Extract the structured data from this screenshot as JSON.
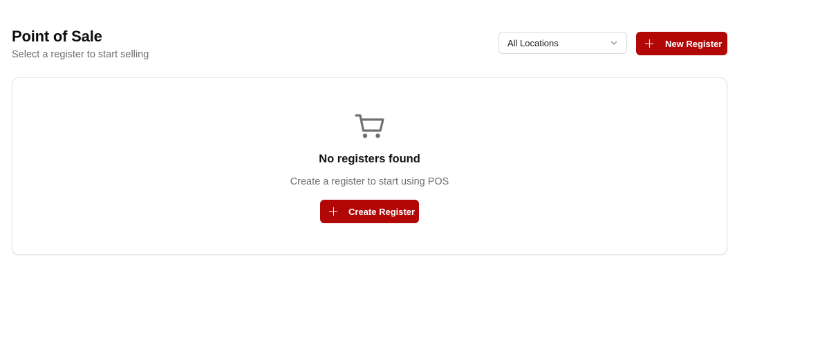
{
  "header": {
    "title": "Point of Sale",
    "subtitle": "Select a register to start selling",
    "location_filter": {
      "selected": "All Locations",
      "icon": "chevron-down-icon"
    },
    "new_register_button": {
      "label": "New Register",
      "icon": "plus-icon"
    }
  },
  "empty_state": {
    "icon": "shopping-cart-icon",
    "title": "No registers found",
    "description": "Create a register to start using POS",
    "create_button": {
      "label": "Create Register",
      "icon": "plus-icon"
    }
  },
  "colors": {
    "primary": "#b20707",
    "icon_gray": "#707070",
    "muted_text": "#6e6e6e",
    "border": "#e2e2e2"
  }
}
